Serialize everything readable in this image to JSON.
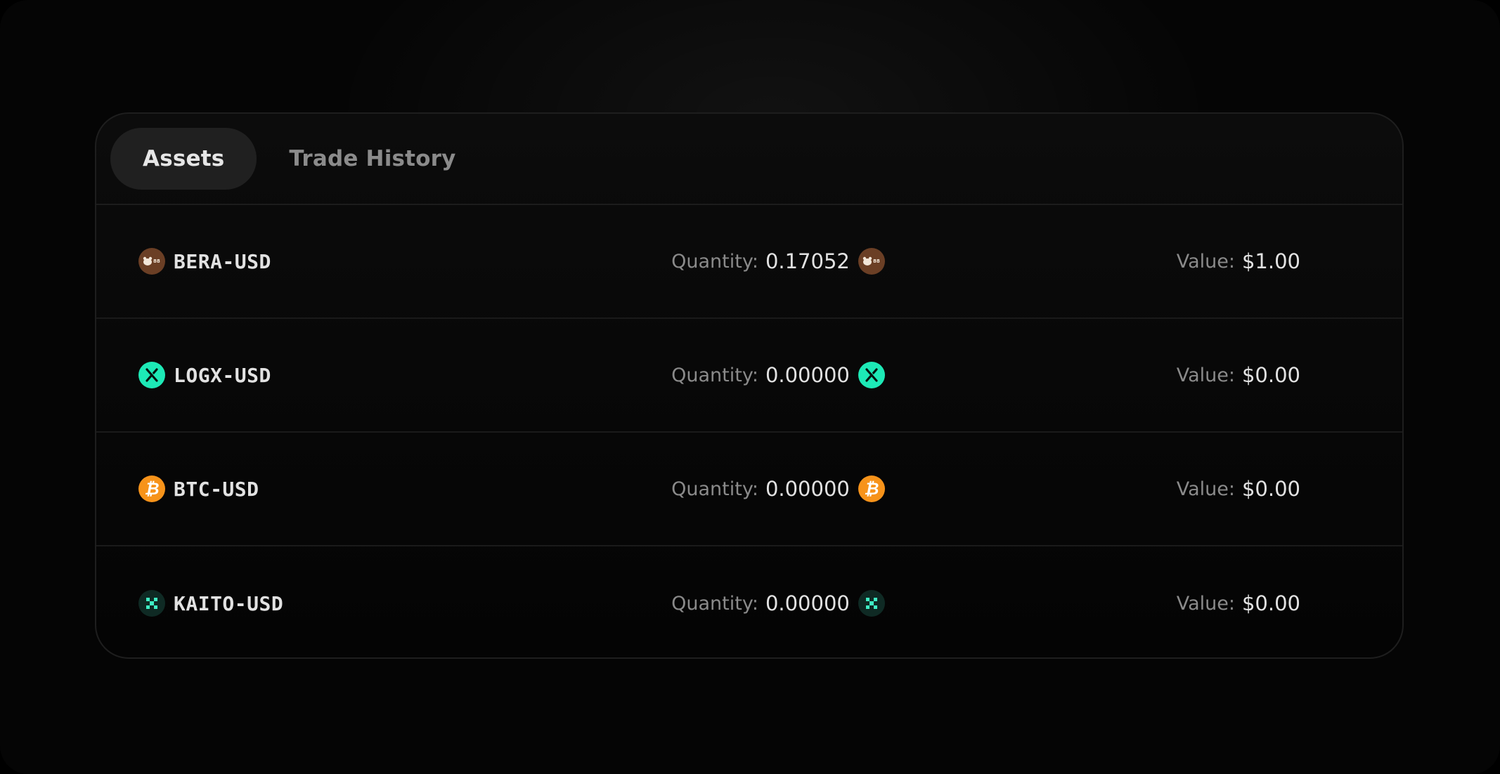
{
  "tabs": [
    {
      "label": "Assets",
      "active": true
    },
    {
      "label": "Trade History",
      "active": false
    }
  ],
  "assets": [
    {
      "pair": "BERA-USD",
      "icon": "bera-icon",
      "icon_color": "#6b3f25",
      "quantity_label": "Quantity:",
      "quantity": "0.17052",
      "value_label": "Value:",
      "value": "$1.00"
    },
    {
      "pair": "LOGX-USD",
      "icon": "logx-icon",
      "icon_color": "#1de9b6",
      "quantity_label": "Quantity:",
      "quantity": "0.00000",
      "value_label": "Value:",
      "value": "$0.00"
    },
    {
      "pair": "BTC-USD",
      "icon": "bitcoin-icon",
      "icon_color": "#f7931a",
      "quantity_label": "Quantity:",
      "quantity": "0.00000",
      "value_label": "Value:",
      "value": "$0.00"
    },
    {
      "pair": "KAITO-USD",
      "icon": "kaito-icon",
      "icon_color": "#0f2a24",
      "quantity_label": "Quantity:",
      "quantity": "0.00000",
      "value_label": "Value:",
      "value": "$0.00"
    }
  ]
}
